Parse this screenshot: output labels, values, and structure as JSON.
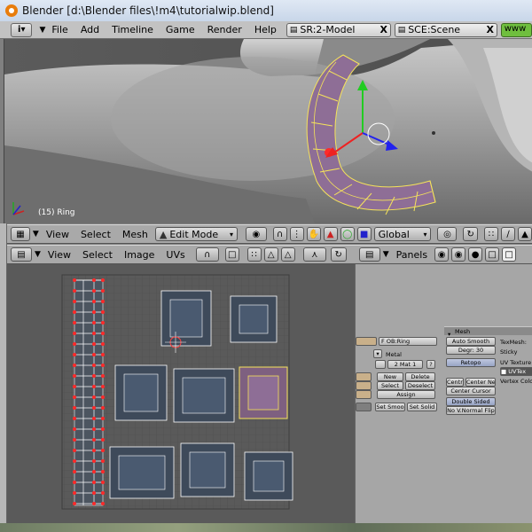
{
  "window": {
    "title": "Blender [d:\\Blender files\\!m4\\tutorialwip.blend]"
  },
  "menubar": {
    "info_icon": "i",
    "menus": [
      "File",
      "Add",
      "Timeline",
      "Game",
      "Render",
      "Help"
    ],
    "screen_field": "SR:2-Model",
    "scene_field": "SCE:Scene",
    "x_glyph": "X",
    "extra": "www"
  },
  "view3d": {
    "object_label": "(15) Ring",
    "header": {
      "menus": [
        "View",
        "Select",
        "Mesh"
      ],
      "mode": "Edit Mode",
      "orientation": "Global"
    }
  },
  "uv_editor": {
    "header": {
      "menus": [
        "View",
        "Select",
        "Image",
        "UVs"
      ]
    }
  },
  "buttons_window": {
    "header": {
      "panels_label": "Panels"
    },
    "link_panel": {
      "ob_field": "OB:Ring",
      "me_prefix": "F",
      "name_field": "Metal",
      "mat_field": "2 Mat 1",
      "question": "?",
      "new": "New",
      "delete": "Delete",
      "select": "Select",
      "deselect": "Deselect",
      "assign": "Assign",
      "set_smooth": "Set Smoo",
      "set_solid": "Set Solid"
    },
    "mesh_panel": {
      "title": "Mesh",
      "auto_smooth": "Auto Smooth",
      "degr": "Degr: 30",
      "retopo": "Retopo",
      "centre": "Centre",
      "center_new": "Center Ne",
      "center_cursor": "Center Cursor",
      "double_sided": "Double Sided",
      "no_vnormal_flip": "No V.Normal Flip",
      "texmesh": "TexMesh:",
      "sticky": "Sticky",
      "uv_texture": "UV Texture",
      "uvtex": "UVTex",
      "vertex_color": "Vertex Colo"
    }
  },
  "colors": {
    "accent_selected": "#f5e35a",
    "vertex_selected": "#ff2a2a",
    "face_selected": "#9a6e9a"
  }
}
